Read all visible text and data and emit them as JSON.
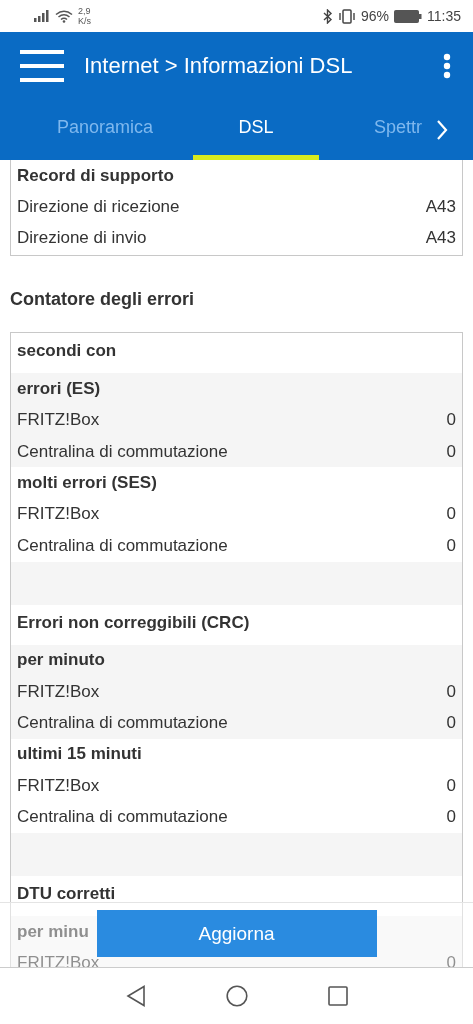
{
  "status_bar": {
    "speed_value": "2,9",
    "speed_unit": "K/s",
    "battery": "96%",
    "time": "11:35"
  },
  "header": {
    "title": "Internet > Informazioni DSL"
  },
  "tabs": [
    {
      "label": "Panoramica",
      "selected": false
    },
    {
      "label": "DSL",
      "selected": true
    },
    {
      "label": "Spettr",
      "selected": false
    }
  ],
  "support_card": {
    "heading": "Record di supporto",
    "rows": [
      {
        "label": "Direzione di ricezione",
        "value": "A43"
      },
      {
        "label": "Direzione di invio",
        "value": "A43"
      }
    ]
  },
  "error_counter": {
    "title": "Contatore degli errori",
    "sections": [
      {
        "heading": "secondi con",
        "groups": [
          {
            "title": "errori (ES)",
            "rows": [
              {
                "label": "FRITZ!Box",
                "value": "0"
              },
              {
                "label": "Centralina di commutazione",
                "value": "0"
              }
            ]
          },
          {
            "title": "molti errori (SES)",
            "rows": [
              {
                "label": "FRITZ!Box",
                "value": "0"
              },
              {
                "label": "Centralina di commutazione",
                "value": "0"
              }
            ]
          }
        ]
      },
      {
        "heading": "Errori non correggibili (CRC)",
        "groups": [
          {
            "title": "per minuto",
            "rows": [
              {
                "label": "FRITZ!Box",
                "value": "0"
              },
              {
                "label": "Centralina di commutazione",
                "value": "0"
              }
            ]
          },
          {
            "title": "ultimi 15 minuti",
            "rows": [
              {
                "label": "FRITZ!Box",
                "value": "0"
              },
              {
                "label": "Centralina di commutazione",
                "value": "0"
              }
            ]
          }
        ]
      },
      {
        "heading": "DTU corretti",
        "groups": [
          {
            "title": "per minu",
            "rows": [
              {
                "label": "FRITZ!Box",
                "value": "0"
              }
            ]
          }
        ]
      }
    ]
  },
  "action_button": "Aggiorna"
}
